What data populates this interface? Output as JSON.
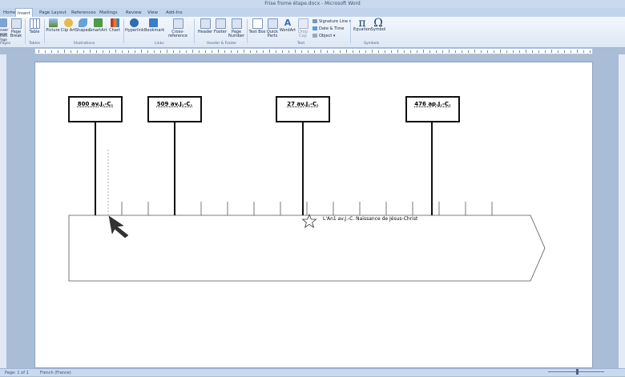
{
  "window": {
    "title": "Frise frome étape.docx - Microsoft Word"
  },
  "tabs": [
    {
      "label": "Home",
      "active": false
    },
    {
      "label": "Insert",
      "active": true
    },
    {
      "label": "Page Layout",
      "active": false
    },
    {
      "label": "References",
      "active": false
    },
    {
      "label": "Mailings",
      "active": false
    },
    {
      "label": "Review",
      "active": false
    },
    {
      "label": "View",
      "active": false
    },
    {
      "label": "Add-Ins",
      "active": false
    }
  ],
  "ribbon": {
    "buttons": {
      "cover_page": "Cover Page",
      "blank_page": "Blank Page",
      "page_break": "Page Break",
      "table": "Table",
      "picture": "Picture",
      "clip_art": "Clip Art",
      "shapes": "Shapes",
      "smartart": "SmartArt",
      "chart": "Chart",
      "hyperlink": "Hyperlink",
      "bookmark": "Bookmark",
      "cross_reference": "Cross-reference",
      "header": "Header",
      "footer": "Footer",
      "page_number": "Page Number",
      "text_box": "Text Box",
      "quick_parts": "Quick Parts",
      "wordart": "WordArt",
      "drop_cap": "Drop Cap",
      "signature_line": "Signature Line",
      "date_time": "Date & Time",
      "object": "Object",
      "equation": "Equation",
      "symbol": "Symbol"
    },
    "groups": {
      "pages": "Pages",
      "tables": "Tables",
      "illustrations": "Illustrations",
      "links": "Links",
      "header_footer": "Header & Footer",
      "text": "Text",
      "symbols": "Symbols"
    }
  },
  "timeline": {
    "dates": [
      "800 av.J.-C.",
      "509 av.J.-C.",
      "27 av.J.-C.",
      "476 ap.J.-C."
    ],
    "caption": "L'An1 av.J.-C. Naissance de Jésus-Christ"
  },
  "status": {
    "page": "Page: 1 of 1",
    "language": "French (France)",
    "zoom_level": 0.52
  },
  "colors": {
    "ribbon_accent": "#c2d4ec",
    "page_background": "#ffffff",
    "line": "#111111"
  }
}
